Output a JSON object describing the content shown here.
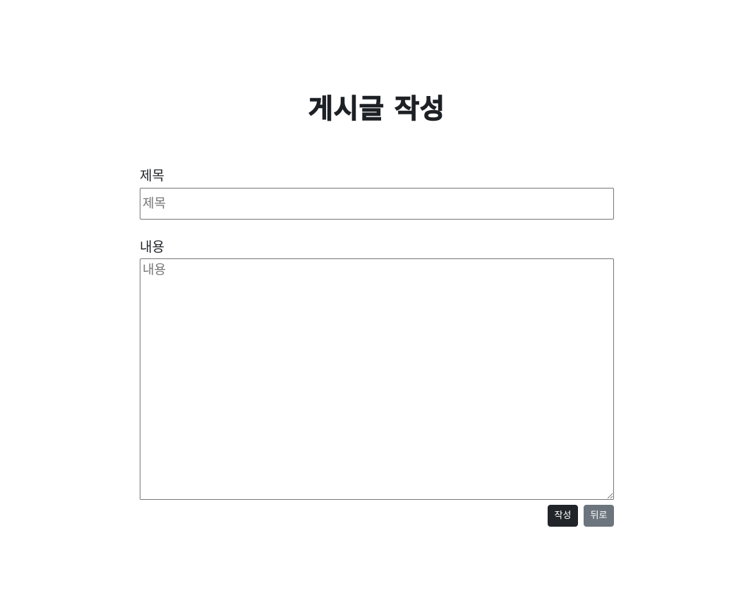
{
  "page": {
    "title": "게시글 작성"
  },
  "form": {
    "title_field": {
      "label": "제목",
      "placeholder": "제목",
      "value": ""
    },
    "content_field": {
      "label": "내용",
      "placeholder": "내용",
      "value": ""
    },
    "buttons": {
      "submit_label": "작성",
      "back_label": "뒤로"
    }
  },
  "colors": {
    "submit_button": "#212529",
    "back_button": "#6c757d",
    "text": "#212529",
    "border": "#767676"
  }
}
